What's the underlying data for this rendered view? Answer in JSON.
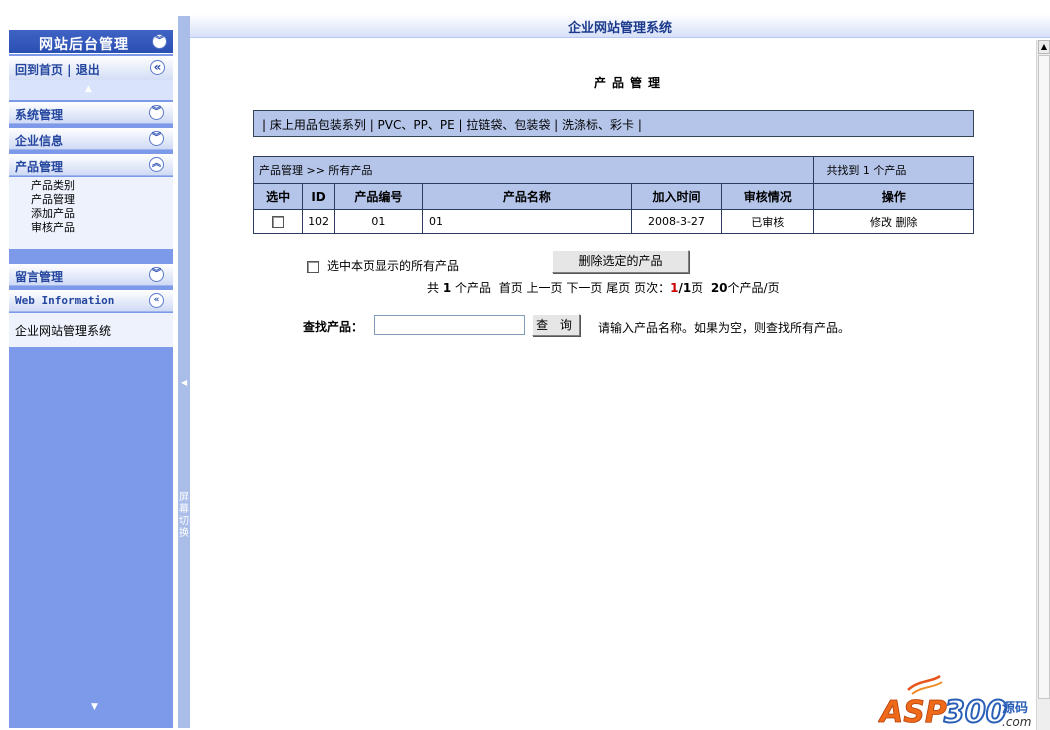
{
  "app": {
    "title": "企业网站管理系统"
  },
  "sidebar": {
    "header": "网站后台管理",
    "links": "回到首页 | 退出",
    "sections": [
      {
        "label": "系统管理",
        "state": "collapsed"
      },
      {
        "label": "企业信息",
        "state": "collapsed"
      },
      {
        "label": "产品管理",
        "state": "expanded",
        "items": [
          "产品类别",
          "产品管理",
          "添加产品",
          "审核产品"
        ]
      },
      {
        "label": "留言管理",
        "state": "collapsed"
      }
    ],
    "info": {
      "label": "Web Information",
      "text": "企业网站管理系统"
    }
  },
  "splitter": {
    "label": "屏幕切换"
  },
  "page": {
    "title": "产品管理",
    "categories": [
      "床上用品包装系列",
      "PVC、PP、PE",
      "拉链袋、包装袋",
      "洗涤标、彩卡"
    ],
    "table": {
      "breadcrumb": "产品管理 >> 所有产品",
      "found": "共找到 1 个产品",
      "columns": [
        "选中",
        "ID",
        "产品编号",
        "产品名称",
        "加入时间",
        "审核情况",
        "操作"
      ],
      "rows": [
        {
          "id": "102",
          "code": "01",
          "name": "01",
          "date": "2008-3-27",
          "status": "已审核",
          "edit": "修改",
          "delete": "删除"
        }
      ]
    },
    "select_all_label": "选中本页显示的所有产品",
    "delete_selected": "删除选定的产品",
    "pager": {
      "total_prefix": "共",
      "total": "1",
      "total_suffix": "个产品",
      "first": "首页",
      "prev": "上一页",
      "next": "下一页",
      "last": "尾页",
      "pages_label": "页次：",
      "current": "1",
      "total_pages": "/1",
      "pages_suffix": "页",
      "per_page": "20",
      "per_page_suffix": "个产品/页"
    },
    "search": {
      "label": "查找产品：",
      "value": "",
      "button": "查 询",
      "hint": "请输入产品名称。如果为空，则查找所有产品。"
    }
  },
  "watermark": {
    "text": "ASP300",
    "suffix": "源码",
    "domain": ".com"
  },
  "colors": {
    "sidebar_bg": "#7c9ae9",
    "header_blue": "#2a4fb3",
    "table_bg": "#b5c5ea",
    "accent_red": "#cc0000"
  }
}
